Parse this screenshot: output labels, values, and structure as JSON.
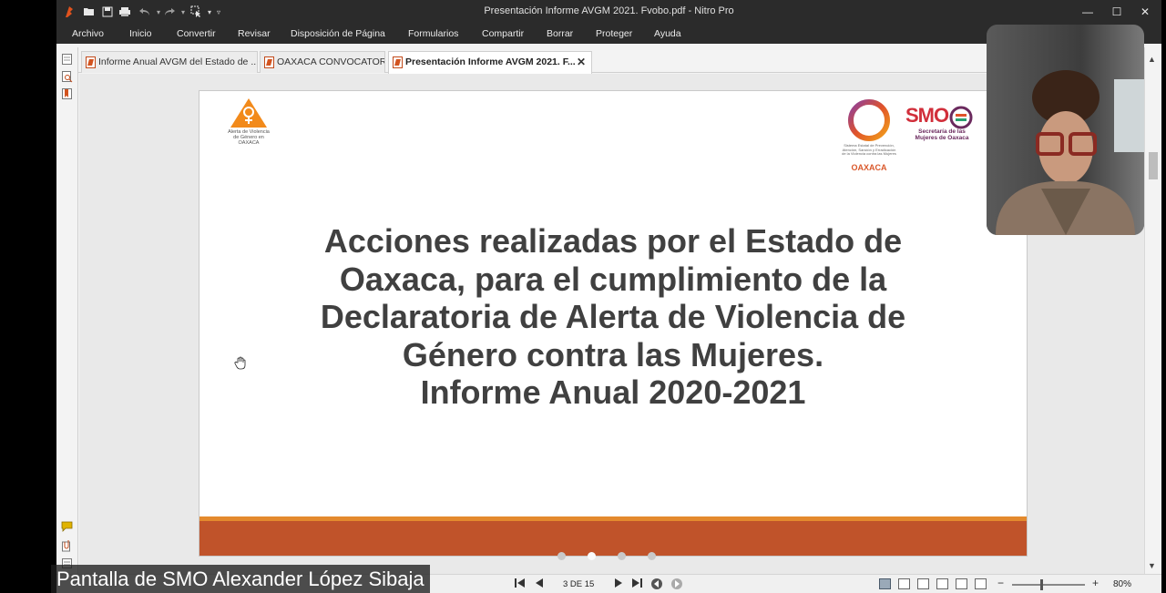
{
  "window": {
    "title": "Presentación Informe AVGM 2021. Fvobo.pdf - Nitro Pro",
    "minimize": "—",
    "maximize": "☐",
    "close": "✕"
  },
  "menu": [
    "Archivo",
    "Inicio",
    "Convertir",
    "Revisar",
    "Disposición de Página",
    "Formularios",
    "Compartir",
    "Borrar",
    "Proteger",
    "Ayuda"
  ],
  "tabs": [
    {
      "label": "Informe Anual AVGM del Estado de ...",
      "active": false
    },
    {
      "label": "OAXACA CONVOCATORIA",
      "active": false
    },
    {
      "label": "Presentación Informe AVGM 2021. F...",
      "active": true,
      "close": "✕"
    }
  ],
  "slide": {
    "title_lines": [
      "Acciones realizadas por el Estado de",
      "Oaxaca, para el cumplimiento de la",
      "Declaratoria de Alerta de Violencia de",
      "Género contra las Mujeres.",
      "Informe Anual 2020-2021"
    ],
    "logo_avgm": [
      "Alerta de Violencia",
      "de Género en",
      "OAXACA"
    ],
    "logo_sistema": [
      "Sistema Estatal de Prevención,",
      "Atención, Sanción y Erradicación",
      "de la Violencia contra las Mujeres"
    ],
    "logo_sistema_oaxaca": "OAXACA",
    "logo_smo": "SMO",
    "logo_smo_sub": [
      "Secretaría de las",
      "Mujeres de Oaxaca"
    ],
    "colors": {
      "stripe_main": "#c0532a",
      "stripe_accent": "#e48a2e",
      "title": "#404040"
    }
  },
  "status": {
    "page_indicator": "3 DE 15",
    "zoom": "80%",
    "zoom_minus": "−",
    "zoom_plus": "+"
  },
  "caption": "Pantalla de SMO Alexander López Sibaja",
  "icons": [
    "nitro-logo-icon",
    "open-folder-icon",
    "save-icon",
    "print-icon",
    "undo-icon",
    "redo-icon",
    "select-tool-icon",
    "hand-cursor-icon",
    "comment-icon",
    "attachment-icon",
    "first-page-icon",
    "prev-page-icon",
    "next-page-icon",
    "last-page-icon",
    "back-view-icon",
    "forward-view-icon"
  ]
}
